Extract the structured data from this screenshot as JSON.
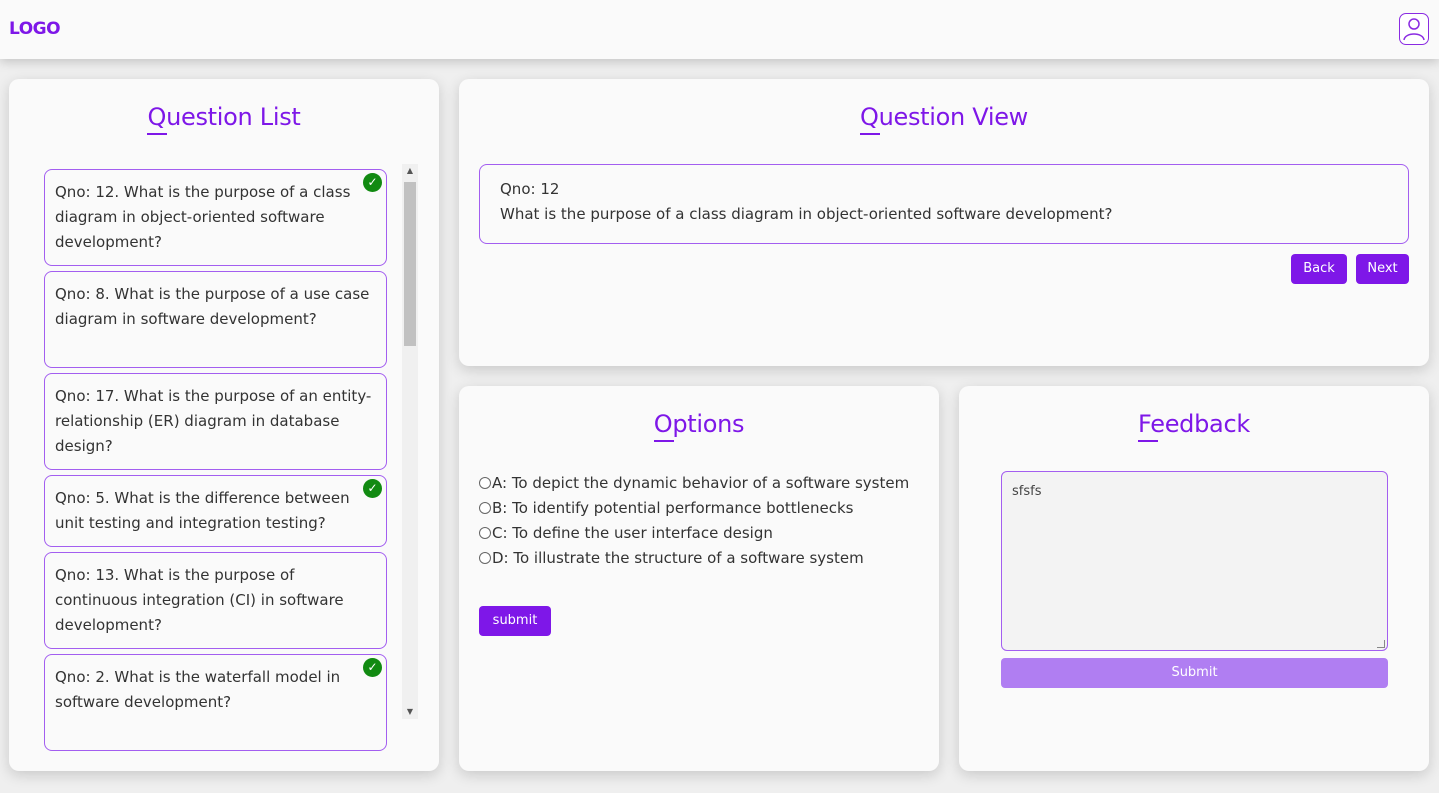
{
  "header": {
    "logo": "LOGO",
    "profile_icon": "user-icon"
  },
  "colors": {
    "accent": "#7e17e8",
    "check_green": "#118a11",
    "disabled_button": "#b07ef2"
  },
  "question_list": {
    "title": "Question List",
    "items": [
      {
        "text": "Qno: 12. What is the purpose of a class diagram in object-oriented software development?",
        "answered": true
      },
      {
        "text": "Qno: 8. What is the purpose of a use case diagram in software development?",
        "answered": false
      },
      {
        "text": "Qno: 17. What is the purpose of an entity-relationship (ER) diagram in database design?",
        "answered": false
      },
      {
        "text": "Qno: 5. What is the difference between unit testing and integration testing?",
        "answered": true
      },
      {
        "text": "Qno: 13. What is the purpose of continuous integration (CI) in software development?",
        "answered": false
      },
      {
        "text": "Qno: 2. What is the waterfall model in software development?",
        "answered": true
      }
    ]
  },
  "question_view": {
    "title": "Question View",
    "qno": "Qno: 12",
    "question": "What is the purpose of a class diagram in object-oriented software development?",
    "back_label": "Back",
    "next_label": "Next"
  },
  "options": {
    "title": "Options",
    "items": [
      "A: To depict the dynamic behavior of a software system",
      "B: To identify potential performance bottlenecks",
      "C: To define the user interface design",
      "D: To illustrate the structure of a software system"
    ],
    "submit_label": "submit"
  },
  "feedback": {
    "title": "Feedback",
    "value": "sfsfs",
    "submit_label": "Submit"
  }
}
